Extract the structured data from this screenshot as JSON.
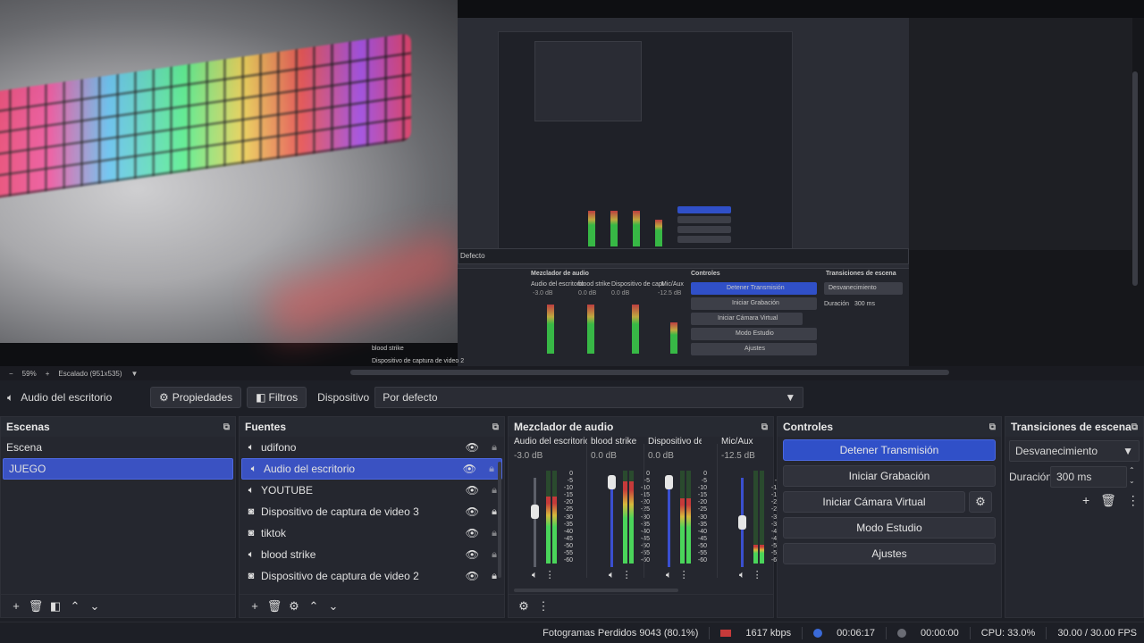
{
  "preview": {
    "zoom": "59%",
    "scale_label": "Escalado (951x535)",
    "nested_labels": {
      "mixer": "Mezclador de audio",
      "controls": "Controles",
      "transitions": "Transiciones de escena",
      "stop_stream": "Detener Transmisión",
      "start_recording": "Iniciar Grabación",
      "virtual_cam": "Iniciar Cámara Virtual",
      "studio": "Modo Estudio",
      "settings": "Ajustes",
      "fade": "Desvanecimiento",
      "duration": "Duración",
      "duration_val": "300 ms",
      "defecto": "Defecto",
      "blood": "blood strike",
      "capture2": "Dispositivo de captura de video 2",
      "ch1": "Audio del escritorio",
      "ch2": "blood strike",
      "ch3": "Dispositivo de capt",
      "ch4": "Mic/Aux",
      "db1": "-3.0 dB",
      "db2": "0.0 dB",
      "db3": "0.0 dB",
      "db4": "-12.5 dB"
    }
  },
  "propsbar": {
    "source": "Audio del escritorio",
    "properties": "Propiedades",
    "filters": "Filtros",
    "device_label": "Dispositivo",
    "device_value": "Por defecto"
  },
  "scenes": {
    "title": "Escenas",
    "items": [
      "Escena",
      "JUEGO"
    ],
    "selected": 1
  },
  "sources": {
    "title": "Fuentes",
    "items": [
      {
        "name": "udifono",
        "icon": "speaker-icon",
        "locked": false
      },
      {
        "name": "Audio del escritorio",
        "icon": "speaker-icon",
        "locked": false
      },
      {
        "name": "YOUTUBE",
        "icon": "speaker-icon",
        "locked": false
      },
      {
        "name": "Dispositivo de captura de video 3",
        "icon": "camera-icon",
        "locked": true
      },
      {
        "name": "tiktok",
        "icon": "camera-icon",
        "locked": false
      },
      {
        "name": "blood strike",
        "icon": "speaker-icon",
        "locked": false
      },
      {
        "name": "Dispositivo de captura de video 2",
        "icon": "camera-icon",
        "locked": true
      }
    ],
    "selected": 1
  },
  "mixer": {
    "title": "Mezclador de audio",
    "channels": [
      {
        "name": "Audio del escritorio",
        "db": "-3.0 dB",
        "fader": 0.62,
        "level": 0.72,
        "active": false
      },
      {
        "name": "blood strike",
        "db": "0.0 dB",
        "fader": 0.95,
        "level": 0.88,
        "active": true
      },
      {
        "name": "Dispositivo de capt",
        "db": "0.0 dB",
        "fader": 0.95,
        "level": 0.7,
        "active": true
      },
      {
        "name": "Mic/Aux",
        "db": "-12.5 dB",
        "fader": 0.5,
        "level": 0.2,
        "active": true
      }
    ],
    "ticks": [
      "0",
      "-5",
      "-10",
      "-15",
      "-20",
      "-25",
      "-30",
      "-35",
      "-40",
      "-45",
      "-50",
      "-55",
      "-60"
    ]
  },
  "controls": {
    "title": "Controles",
    "stop_stream": "Detener Transmisión",
    "start_recording": "Iniciar Grabación",
    "virtual_cam": "Iniciar Cámara Virtual",
    "studio_mode": "Modo Estudio",
    "settings": "Ajustes"
  },
  "transitions": {
    "title": "Transiciones de escena",
    "selected": "Desvanecimiento",
    "duration_label": "Duración",
    "duration_value": "300 ms"
  },
  "status": {
    "dropped_frames": "Fotogramas Perdidos 9043 (80.1%)",
    "bitrate": "1617 kbps",
    "stream_time": "00:06:17",
    "rec_time": "00:00:00",
    "cpu": "CPU: 33.0%",
    "fps": "30.00 / 30.00 FPS"
  },
  "colors": {
    "accent": "#3a52c2",
    "panel": "#25272f",
    "background": "#1d1f26"
  }
}
